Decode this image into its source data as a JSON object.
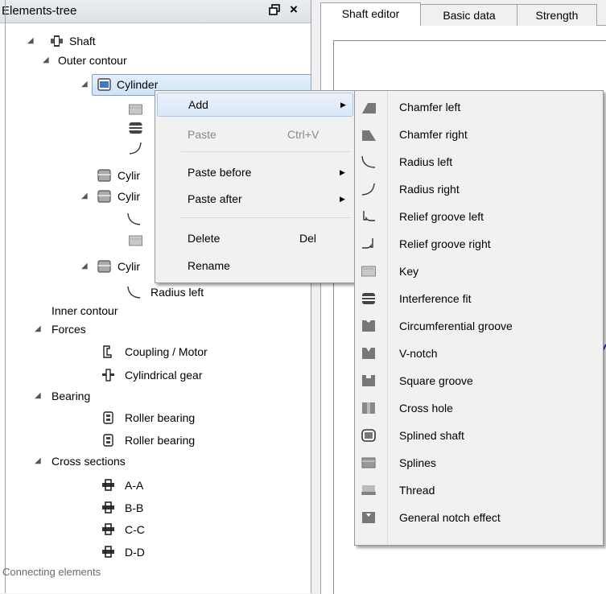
{
  "left_panel": {
    "title": "Elements-tree",
    "tree": {
      "shaft": "Shaft",
      "outer_contour": "Outer contour",
      "cylinder1": "Cylinder",
      "cylinder_partial_a": "Cylir",
      "cylinder_partial_b": "Cylir",
      "cylinder_partial_c": "Cylir",
      "radius_left": "Radius left",
      "inner_contour": "Inner contour",
      "forces": "Forces",
      "coupling_motor": "Coupling / Motor",
      "cylindrical_gear": "Cylindrical gear",
      "bearing": "Bearing",
      "roller_bearing_1": "Roller bearing",
      "roller_bearing_2": "Roller bearing",
      "cross_sections": "Cross sections",
      "section_aa": "A-A",
      "section_bb": "B-B",
      "section_cc": "C-C",
      "section_dd": "D-D",
      "connecting_elements": "Connecting elements"
    }
  },
  "tabs": [
    "Shaft editor",
    "Basic data",
    "Strength"
  ],
  "context_menu": {
    "add": "Add",
    "paste": "Paste",
    "paste_shortcut": "Ctrl+V",
    "paste_before": "Paste before",
    "paste_after": "Paste after",
    "delete": "Delete",
    "delete_shortcut": "Del",
    "rename": "Rename"
  },
  "submenu": [
    {
      "label": "Chamfer left",
      "icon": "chamfer-left-icon"
    },
    {
      "label": "Chamfer right",
      "icon": "chamfer-right-icon"
    },
    {
      "label": "Radius left",
      "icon": "radius-left-icon"
    },
    {
      "label": "Radius right",
      "icon": "radius-right-icon"
    },
    {
      "label": "Relief groove left",
      "icon": "relief-groove-left-icon"
    },
    {
      "label": "Relief groove right",
      "icon": "relief-groove-right-icon"
    },
    {
      "label": "Key",
      "icon": "key-icon"
    },
    {
      "label": "Interference fit",
      "icon": "interference-fit-icon"
    },
    {
      "label": "Circumferential groove",
      "icon": "circumferential-groove-icon"
    },
    {
      "label": "V-notch",
      "icon": "v-notch-icon"
    },
    {
      "label": "Square groove",
      "icon": "square-groove-icon"
    },
    {
      "label": "Cross hole",
      "icon": "cross-hole-icon"
    },
    {
      "label": "Splined shaft",
      "icon": "splined-shaft-icon"
    },
    {
      "label": "Splines",
      "icon": "splines-icon"
    },
    {
      "label": "Thread",
      "icon": "thread-icon"
    },
    {
      "label": "General notch effect",
      "icon": "general-notch-effect-icon"
    }
  ],
  "colors": {
    "selection_border": "#7da2ce",
    "highlight": "#d9e8f8",
    "disabled_text": "#8a8a8a",
    "drawing_line": "#2a2ad0"
  }
}
